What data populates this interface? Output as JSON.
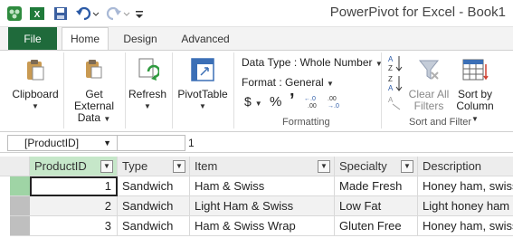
{
  "window": {
    "title": "PowerPivot for Excel - Book1"
  },
  "quick_access": {
    "icons": [
      "powerpivot-icon",
      "excel-icon",
      "save-icon",
      "undo-icon",
      "redo-icon",
      "customize-icon"
    ]
  },
  "tabs": [
    {
      "label": "File"
    },
    {
      "label": "Home",
      "active": true
    },
    {
      "label": "Design"
    },
    {
      "label": "Advanced"
    }
  ],
  "ribbon": {
    "clipboard": {
      "label": "Clipboard"
    },
    "get_external_data": {
      "line1": "Get External",
      "line2": "Data"
    },
    "refresh": {
      "label": "Refresh"
    },
    "pivottable": {
      "label": "PivotTable"
    },
    "formatting": {
      "data_type": "Data Type : Whole Number",
      "format": "Format : General",
      "currency_symbol": "$",
      "percent_symbol": "%",
      "comma_symbol": "’",
      "group_label": "Formatting"
    },
    "sort_filter": {
      "clear_filters_line1": "Clear All",
      "clear_filters_line2": "Filters",
      "sort_by_line1": "Sort by",
      "sort_by_line2": "Column",
      "group_label": "Sort and Filter"
    }
  },
  "formula_bar": {
    "name_box": "[ProductID]",
    "value": "1"
  },
  "table": {
    "columns": [
      "ProductID",
      "Type",
      "Item",
      "Specialty",
      "Description"
    ],
    "rows": [
      [
        "1",
        "Sandwich",
        "Ham & Swiss",
        "Made Fresh",
        "Honey ham, swiss"
      ],
      [
        "2",
        "Sandwich",
        "Light Ham & Swiss",
        "Low Fat",
        "Light honey ham"
      ],
      [
        "3",
        "Sandwich",
        "Ham & Swiss Wrap",
        "Gluten Free",
        "Honey ham, swiss"
      ]
    ]
  },
  "colors": {
    "file_tab": "#1f6a3b",
    "selected_header": "#c6e7c9",
    "selected_row_indicator": "#9fd4a5"
  }
}
